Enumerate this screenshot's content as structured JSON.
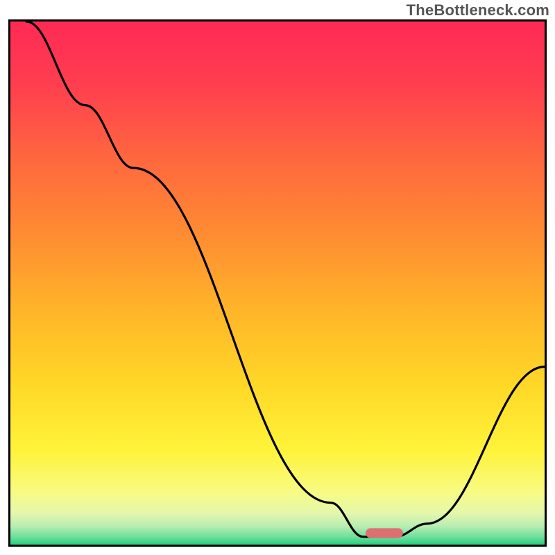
{
  "watermark": "TheBottleneck.com",
  "colors": {
    "gradient_stops": [
      {
        "offset": 0.0,
        "color": "#ff2a55"
      },
      {
        "offset": 0.12,
        "color": "#ff3e4f"
      },
      {
        "offset": 0.25,
        "color": "#ff6440"
      },
      {
        "offset": 0.4,
        "color": "#ff8a32"
      },
      {
        "offset": 0.55,
        "color": "#ffb429"
      },
      {
        "offset": 0.7,
        "color": "#ffd927"
      },
      {
        "offset": 0.82,
        "color": "#fff33a"
      },
      {
        "offset": 0.9,
        "color": "#f8fb83"
      },
      {
        "offset": 0.94,
        "color": "#e4f7ac"
      },
      {
        "offset": 0.965,
        "color": "#b8edb2"
      },
      {
        "offset": 0.985,
        "color": "#6fe09b"
      },
      {
        "offset": 1.0,
        "color": "#27cf7e"
      }
    ],
    "curve": "#000000",
    "marker": "#dd6f72",
    "border": "#000000"
  },
  "chart_data": {
    "type": "line",
    "x_range": [
      0,
      100
    ],
    "y_range": [
      0,
      100
    ],
    "series": [
      {
        "name": "bottleneck-curve",
        "points": [
          {
            "x": 3.0,
            "y": 100.0
          },
          {
            "x": 14.0,
            "y": 84.0
          },
          {
            "x": 23.0,
            "y": 72.0
          },
          {
            "x": 60.0,
            "y": 8.0
          },
          {
            "x": 66.0,
            "y": 1.5
          },
          {
            "x": 72.0,
            "y": 1.5
          },
          {
            "x": 78.0,
            "y": 4.0
          },
          {
            "x": 100.0,
            "y": 34.0
          }
        ]
      }
    ],
    "optimal_marker": {
      "x_start": 66.5,
      "x_end": 73.5,
      "y": 2.2
    },
    "xlabel": "",
    "ylabel": "",
    "title": ""
  }
}
